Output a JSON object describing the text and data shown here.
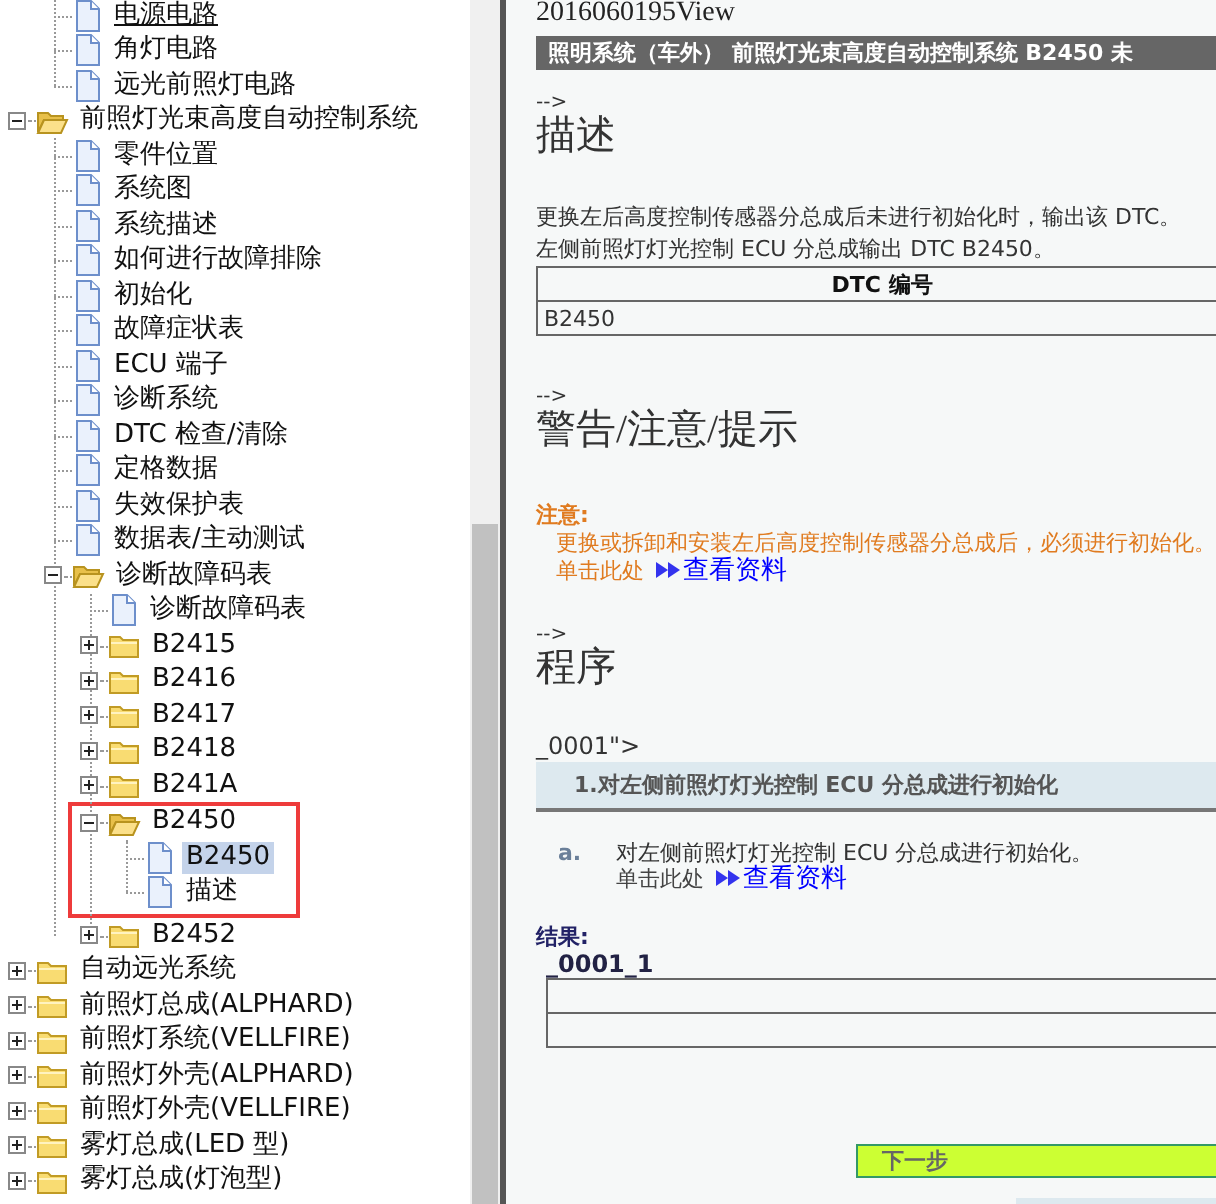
{
  "tree": {
    "continued_items": [
      {
        "label": "电源电路",
        "kind": "page",
        "selected": false,
        "hovered": true
      },
      {
        "label": "角灯电路",
        "kind": "page",
        "selected": false
      },
      {
        "label": "远光前照灯电路",
        "kind": "page",
        "selected": false
      }
    ],
    "items": [
      {
        "label": "前照灯光束高度自动控制系统",
        "kind": "folder",
        "expanded": true,
        "selected": false,
        "children": [
          {
            "label": "零件位置",
            "kind": "page",
            "selected": false
          },
          {
            "label": "系统图",
            "kind": "page",
            "selected": false
          },
          {
            "label": "系统描述",
            "kind": "page",
            "selected": false
          },
          {
            "label": "如何进行故障排除",
            "kind": "page",
            "selected": false
          },
          {
            "label": "初始化",
            "kind": "page",
            "selected": false
          },
          {
            "label": "故障症状表",
            "kind": "page",
            "selected": false
          },
          {
            "label": "ECU 端子",
            "kind": "page",
            "selected": false
          },
          {
            "label": "诊断系统",
            "kind": "page",
            "selected": false
          },
          {
            "label": "DTC 检查/清除",
            "kind": "page",
            "selected": false
          },
          {
            "label": "定格数据",
            "kind": "page",
            "selected": false
          },
          {
            "label": "失效保护表",
            "kind": "page",
            "selected": false
          },
          {
            "label": "数据表/主动测试",
            "kind": "page",
            "selected": false
          },
          {
            "label": "诊断故障码表",
            "kind": "folder",
            "expanded": true,
            "selected": false,
            "children": [
              {
                "label": "诊断故障码表",
                "kind": "page",
                "selected": false
              },
              {
                "label": "B2415",
                "kind": "folder",
                "expanded": false,
                "selected": false
              },
              {
                "label": "B2416",
                "kind": "folder",
                "expanded": false,
                "selected": false
              },
              {
                "label": "B2417",
                "kind": "folder",
                "expanded": false,
                "selected": false
              },
              {
                "label": "B2418",
                "kind": "folder",
                "expanded": false,
                "selected": false
              },
              {
                "label": "B241A",
                "kind": "folder",
                "expanded": false,
                "selected": false
              },
              {
                "label": "B2450",
                "kind": "folder",
                "expanded": true,
                "selected": false,
                "highlighted": true,
                "children": [
                  {
                    "label": "B2450",
                    "kind": "page",
                    "selected": true
                  },
                  {
                    "label": "描述",
                    "kind": "page",
                    "selected": false
                  }
                ]
              },
              {
                "label": "B2452",
                "kind": "folder",
                "expanded": false,
                "selected": false
              }
            ]
          }
        ]
      },
      {
        "label": "自动远光系统",
        "kind": "folder",
        "expanded": false,
        "selected": false
      },
      {
        "label": "前照灯总成(ALPHARD)",
        "kind": "folder",
        "expanded": false,
        "selected": false
      },
      {
        "label": "前照灯系统(VELLFIRE)",
        "kind": "folder",
        "expanded": false,
        "selected": false
      },
      {
        "label": "前照灯外壳(ALPHARD)",
        "kind": "folder",
        "expanded": false,
        "selected": false
      },
      {
        "label": "前照灯外壳(VELLFIRE)",
        "kind": "folder",
        "expanded": false,
        "selected": false
      },
      {
        "label": "雾灯总成(LED 型)",
        "kind": "folder",
        "expanded": false,
        "selected": false
      },
      {
        "label": "雾灯总成(灯泡型)",
        "kind": "folder",
        "expanded": false,
        "selected": false
      }
    ]
  },
  "document": {
    "file_name": "2016060195View",
    "title_bar": "照明系统（车外） 前照灯光束高度自动控制系统 B2450 未",
    "content": [
      {
        "kind": "marker",
        "text": "-->"
      },
      {
        "kind": "heading",
        "text": "描述"
      },
      {
        "kind": "paragraph",
        "lines": [
          "更换左后高度控制传感器分总成后未进行初始化时，输出该 DTC。",
          "左侧前照灯灯光控制 ECU 分总成输出 DTC B2450。"
        ]
      },
      {
        "kind": "table",
        "header": "DTC 编号",
        "rows": [
          "B2450"
        ]
      },
      {
        "kind": "marker",
        "text": "-->"
      },
      {
        "kind": "heading",
        "text": "警告/注意/提示"
      },
      {
        "kind": "notice",
        "label": "注意:",
        "text": "更换或拆卸和安装左后高度控制传感器分总成后，必须进行初始化。",
        "link_prefix": "单击此处",
        "link": "查看资料"
      },
      {
        "kind": "marker",
        "text": "-->"
      },
      {
        "kind": "heading",
        "text": "程序"
      },
      {
        "kind": "anchor",
        "text": "_0001\">"
      },
      {
        "kind": "step",
        "text": "1.对左侧前照灯灯光控制 ECU 分总成进行初始化"
      },
      {
        "kind": "substep",
        "label": "a.",
        "text": "对左侧前照灯灯光控制 ECU 分总成进行初始化。",
        "link_prefix": "单击此处",
        "link": "查看资料"
      },
      {
        "kind": "result",
        "label": "结果:",
        "id": "_0001_1"
      },
      {
        "kind": "next_button",
        "text": "下一步"
      }
    ]
  }
}
